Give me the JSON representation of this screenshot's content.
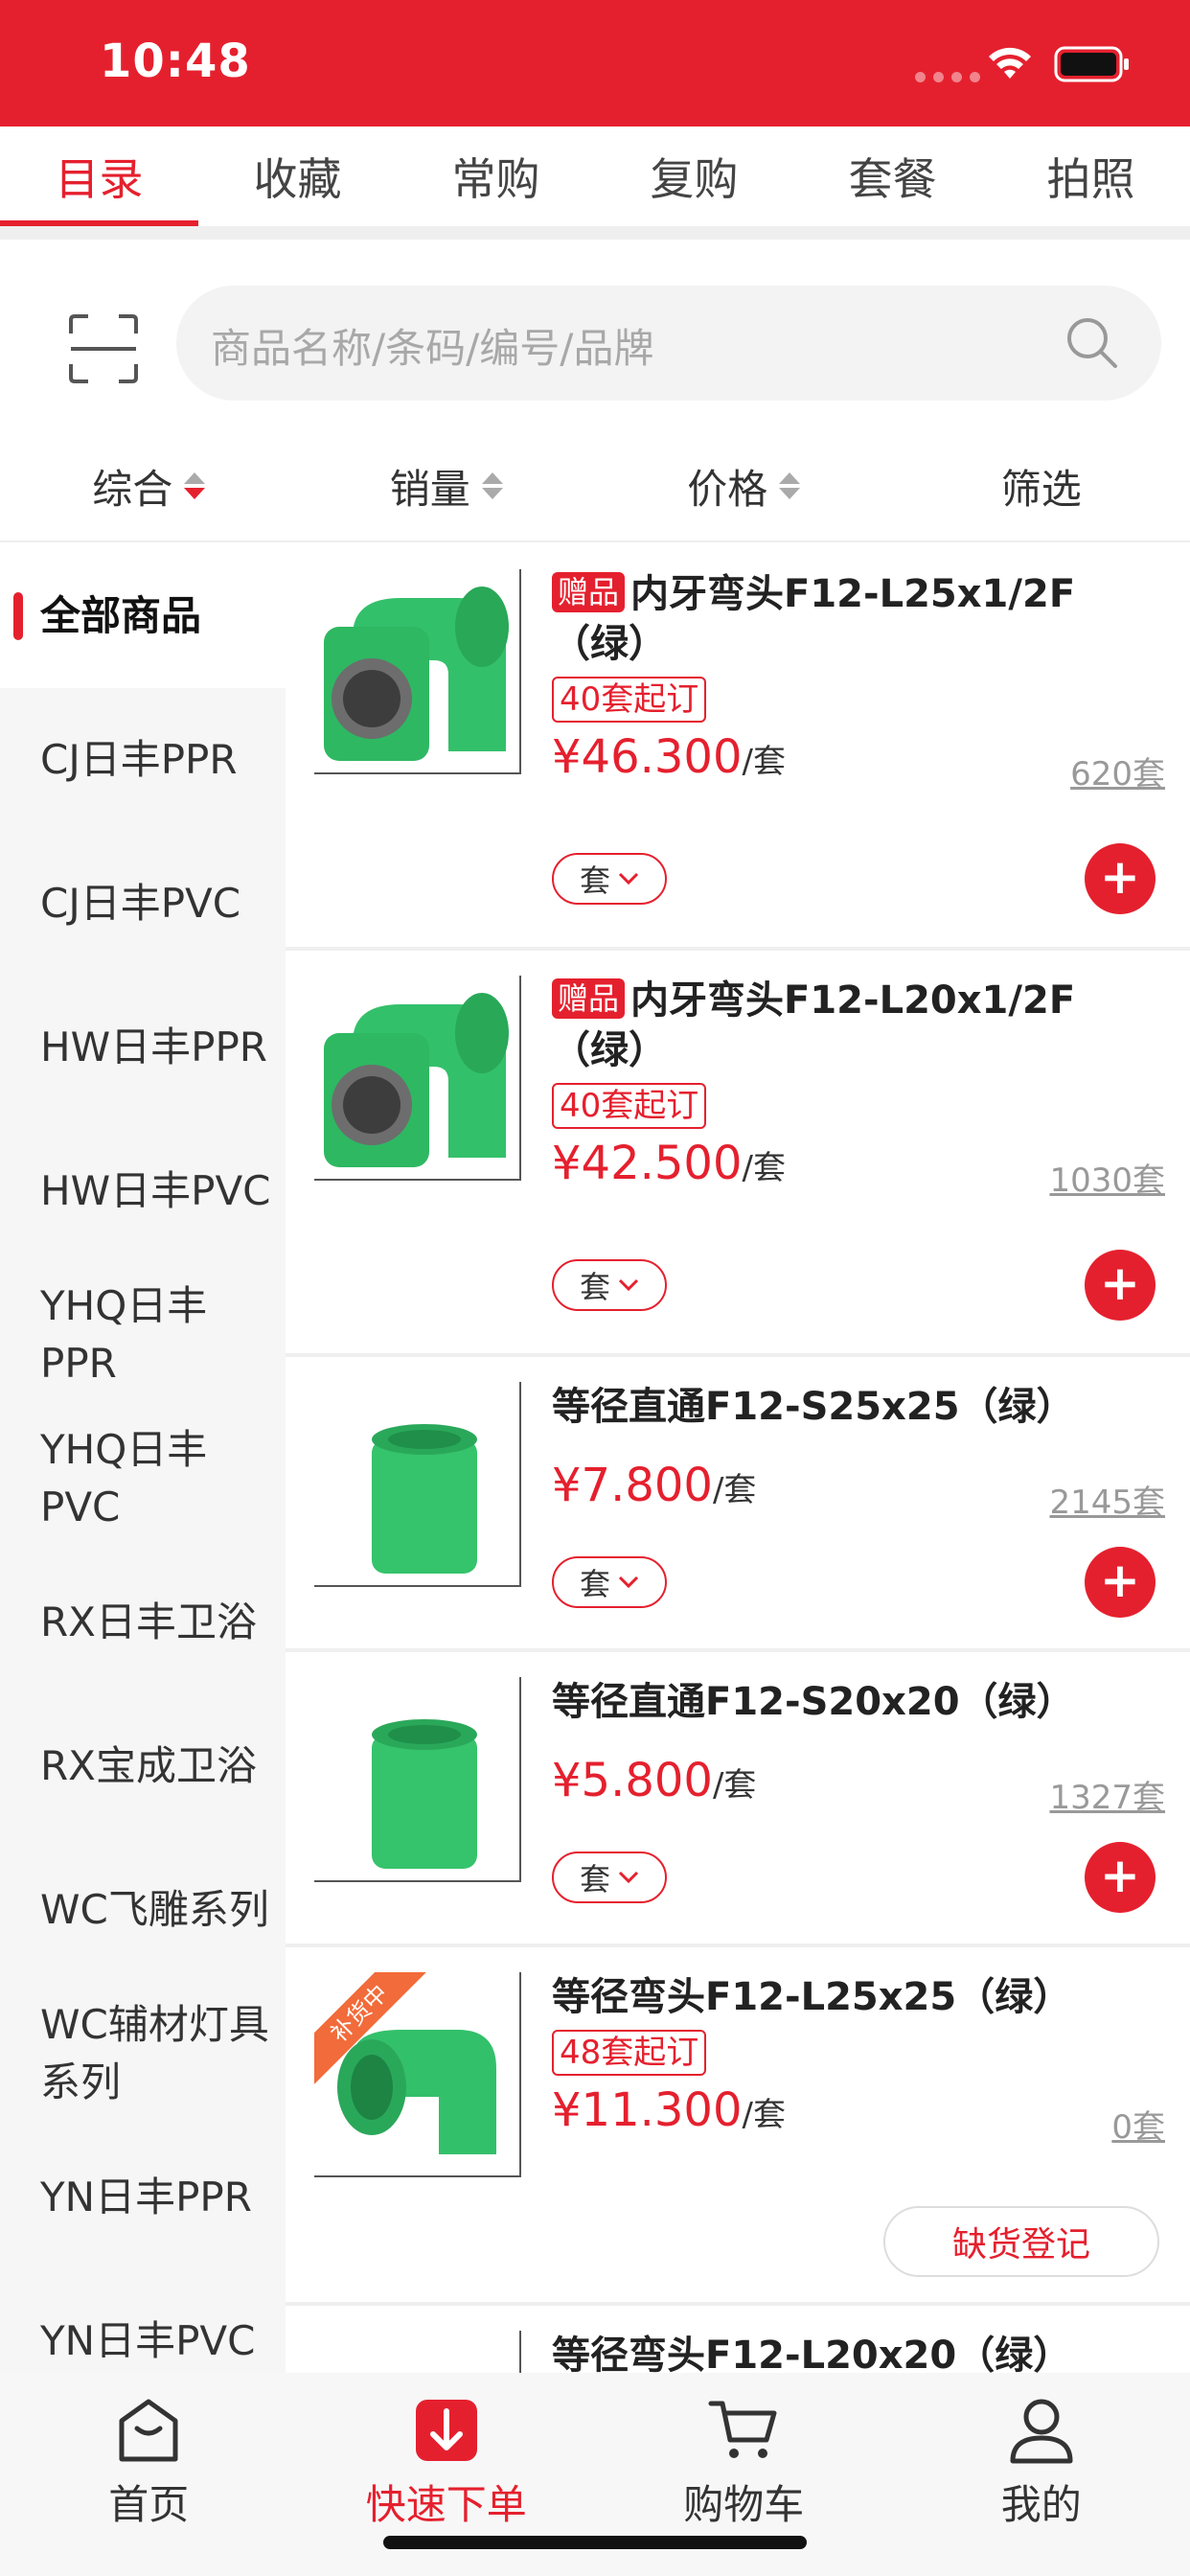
{
  "status_bar": {
    "time": "10:48"
  },
  "top_tabs": [
    {
      "label": "目录",
      "active": true
    },
    {
      "label": "收藏",
      "active": false
    },
    {
      "label": "常购",
      "active": false
    },
    {
      "label": "复购",
      "active": false
    },
    {
      "label": "套餐",
      "active": false
    },
    {
      "label": "拍照",
      "active": false
    }
  ],
  "search": {
    "placeholder": "商品名称/条码/编号/品牌"
  },
  "sort_bar": [
    {
      "label": "综合"
    },
    {
      "label": "销量"
    },
    {
      "label": "价格"
    },
    {
      "label": "筛选"
    }
  ],
  "sidebar": {
    "items": [
      {
        "label": "全部商品",
        "active": true
      },
      {
        "label": "CJ日丰PPR"
      },
      {
        "label": "CJ日丰PVC"
      },
      {
        "label": "HW日丰PPR"
      },
      {
        "label": "HW日丰PVC"
      },
      {
        "label": "YHQ日丰PPR"
      },
      {
        "label": "YHQ日丰PVC"
      },
      {
        "label": "RX日丰卫浴"
      },
      {
        "label": "RX宝成卫浴"
      },
      {
        "label": "WC飞雕系列"
      },
      {
        "label": "WC辅材灯具系列"
      },
      {
        "label": "YN日丰PPR"
      },
      {
        "label": "YN日丰PVC"
      }
    ]
  },
  "products": [
    {
      "gift_tag": "赠品",
      "title": "内牙弯头F12-L25x1/2F（绿）",
      "moq": "40套起订",
      "price": "¥46.300",
      "unit": "/套",
      "stock": "620套",
      "unit_select": "套",
      "add": "+"
    },
    {
      "gift_tag": "赠品",
      "title": "内牙弯头F12-L20x1/2F（绿）",
      "moq": "40套起订",
      "price": "¥42.500",
      "unit": "/套",
      "stock": "1030套",
      "unit_select": "套",
      "add": "+"
    },
    {
      "title": "等径直通F12-S25x25（绿）",
      "price": "¥7.800",
      "unit": "/套",
      "stock": "2145套",
      "unit_select": "套",
      "add": "+"
    },
    {
      "title": "等径直通F12-S20x20（绿）",
      "price": "¥5.800",
      "unit": "/套",
      "stock": "1327套",
      "unit_select": "套",
      "add": "+"
    },
    {
      "ribbon": "补货中",
      "title": "等径弯头F12-L25x25（绿）",
      "moq": "48套起订",
      "price": "¥11.300",
      "unit": "/套",
      "stock": "0套",
      "register": "缺货登记"
    },
    {
      "title": "等径弯头F12-L20x20（绿）"
    }
  ],
  "bottom_nav": [
    {
      "label": "首页",
      "icon": "home-icon"
    },
    {
      "label": "快速下单",
      "icon": "quick-order-icon",
      "active": true
    },
    {
      "label": "购物车",
      "icon": "cart-icon"
    },
    {
      "label": "我的",
      "icon": "profile-icon"
    }
  ],
  "colors": {
    "accent": "#e5202e",
    "product_green": "#34c26a"
  }
}
